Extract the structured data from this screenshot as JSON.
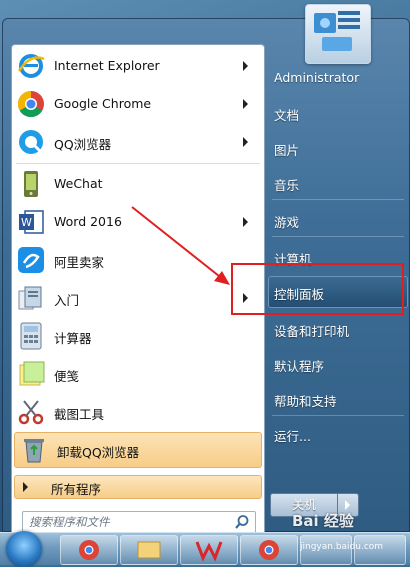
{
  "left_programs": [
    {
      "label": "Internet Explorer",
      "icon": "internet-explorer-icon",
      "has_arrow": true
    },
    {
      "label": "Google Chrome",
      "icon": "chrome-icon",
      "has_arrow": true
    },
    {
      "label": "QQ浏览器",
      "icon": "qq-browser-icon",
      "has_arrow": true
    },
    {
      "label": "WeChat",
      "icon": "wechat-icon",
      "has_arrow": false
    },
    {
      "label": "Word 2016",
      "icon": "word-icon",
      "has_arrow": true
    },
    {
      "label": "阿里卖家",
      "icon": "ali-seller-icon",
      "has_arrow": false
    },
    {
      "label": "入门",
      "icon": "getting-started-icon",
      "has_arrow": true
    },
    {
      "label": "计算器",
      "icon": "calculator-icon",
      "has_arrow": false
    },
    {
      "label": "便笺",
      "icon": "sticky-notes-icon",
      "has_arrow": false
    },
    {
      "label": "截图工具",
      "icon": "snipping-tool-icon",
      "has_arrow": false
    },
    {
      "label": "卸载QQ浏览器",
      "icon": "recycle-bin-icon",
      "has_arrow": false
    }
  ],
  "all_programs": "所有程序",
  "search": {
    "placeholder": "搜索程序和文件"
  },
  "right_items": [
    {
      "label": "Administrator"
    },
    {
      "label": "文档"
    },
    {
      "label": "图片"
    },
    {
      "label": "音乐"
    },
    {
      "label": "游戏"
    },
    {
      "label": "计算机"
    },
    {
      "label": "控制面板"
    },
    {
      "label": "设备和打印机"
    },
    {
      "label": "默认程序"
    },
    {
      "label": "帮助和支持"
    },
    {
      "label": "运行..."
    }
  ],
  "shutdown_label": "关机",
  "watermark": {
    "brand": "Bai 经验",
    "url": "jingyan.baidu.com"
  },
  "colors": {
    "annotation": "#e02020",
    "menu_blue": "#3e6e97",
    "highlight_orange": "#f7cd87"
  }
}
